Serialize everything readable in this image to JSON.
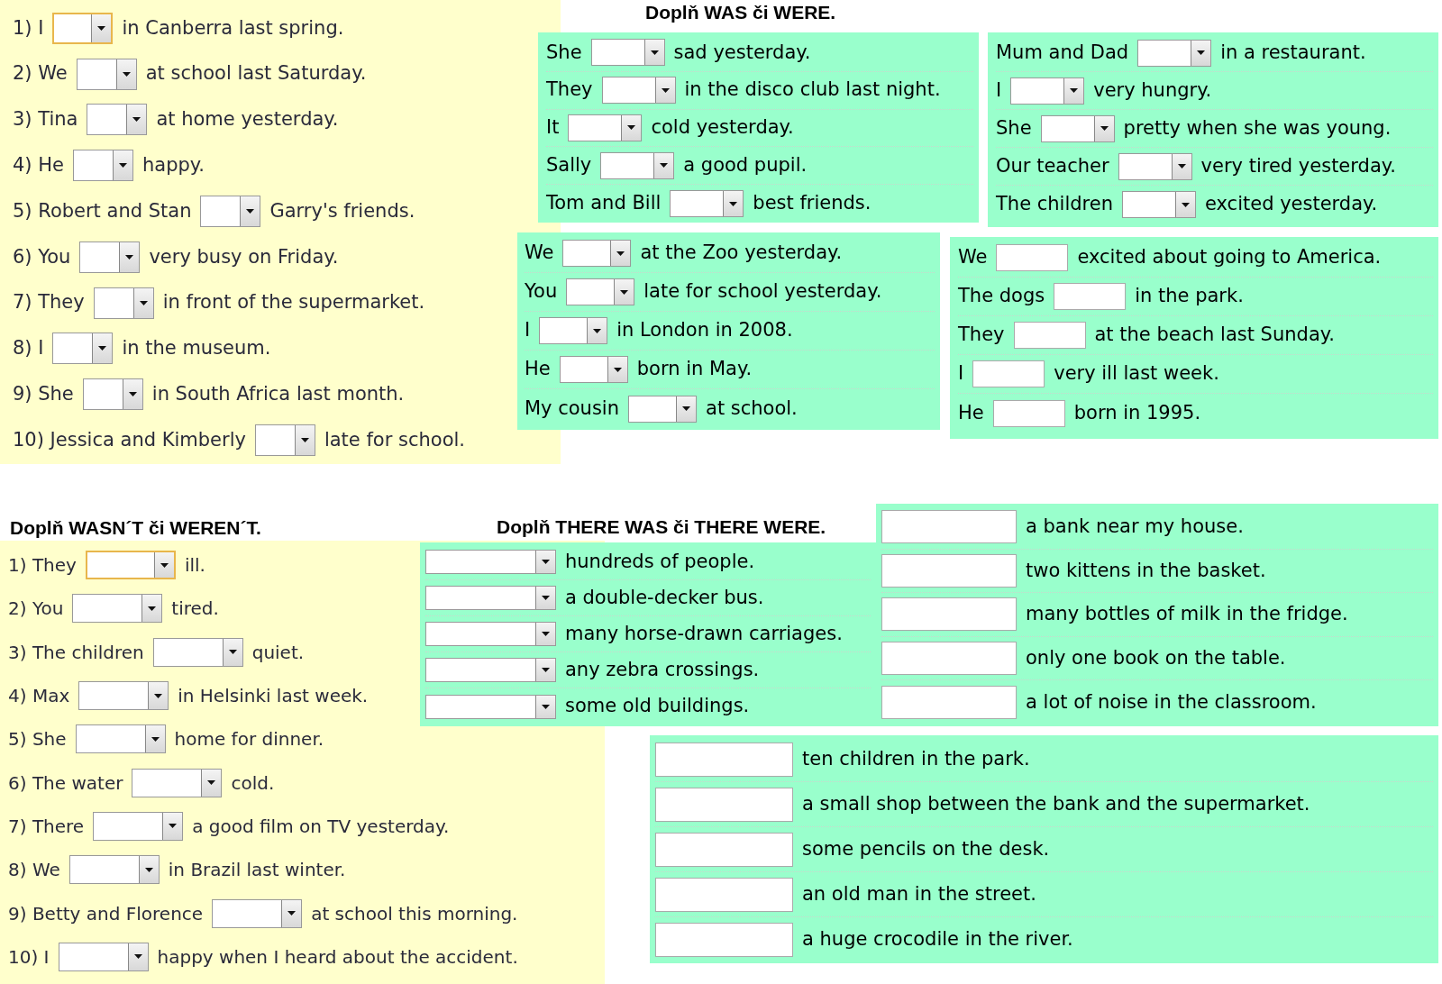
{
  "was_were_numbered": {
    "kind": "select",
    "items": [
      {
        "label": "1) I",
        "rest": "in Canberra last spring.",
        "focused": true
      },
      {
        "label": "2) We",
        "rest": "at school last Saturday.",
        "focused": false
      },
      {
        "label": "3) Tina",
        "rest": "at home yesterday.",
        "focused": false
      },
      {
        "label": "4) He",
        "rest": "happy.",
        "focused": false
      },
      {
        "label": "5) Robert and Stan",
        "rest": "Garry's friends.",
        "focused": false
      },
      {
        "label": "6) You",
        "rest": "very busy on Friday.",
        "focused": false
      },
      {
        "label": "7) They",
        "rest": "in front of the supermarket.",
        "focused": false
      },
      {
        "label": "8) I",
        "rest": "in the museum.",
        "focused": false
      },
      {
        "label": "9) She",
        "rest": "in South Africa last month.",
        "focused": false
      },
      {
        "label": "10) Jessica and Kimberly",
        "rest": "late for school.",
        "focused": false
      }
    ]
  },
  "was_were_title": "Doplň WAS či WERE.",
  "was_were_panels": [
    {
      "kind": "select",
      "items": [
        {
          "subject": "She",
          "rest": "sad yesterday."
        },
        {
          "subject": "They",
          "rest": "in the disco club last night."
        },
        {
          "subject": "It",
          "rest": "cold yesterday."
        },
        {
          "subject": "Sally",
          "rest": "a good pupil."
        },
        {
          "subject": "Tom and Bill",
          "rest": "best friends."
        }
      ]
    },
    {
      "kind": "select",
      "items": [
        {
          "subject": "Mum and Dad",
          "rest": "in a restaurant."
        },
        {
          "subject": "I",
          "rest": "very hungry."
        },
        {
          "subject": "She",
          "rest": "pretty when she was young."
        },
        {
          "subject": "Our teacher",
          "rest": "very tired yesterday."
        },
        {
          "subject": "The children",
          "rest": "excited yesterday."
        }
      ]
    },
    {
      "kind": "select",
      "items": [
        {
          "subject": "We",
          "rest": "at the Zoo yesterday."
        },
        {
          "subject": "You",
          "rest": "late for school yesterday."
        },
        {
          "subject": "I",
          "rest": "in London in 2008."
        },
        {
          "subject": "He",
          "rest": "born in May."
        },
        {
          "subject": "My cousin",
          "rest": "at school."
        }
      ]
    },
    {
      "kind": "text",
      "items": [
        {
          "subject": "We",
          "rest": "excited about going to America."
        },
        {
          "subject": "The dogs",
          "rest": "in the park."
        },
        {
          "subject": "They",
          "rest": "at the beach last Sunday."
        },
        {
          "subject": "I",
          "rest": "very ill last week."
        },
        {
          "subject": "He",
          "rest": "born in 1995."
        }
      ]
    }
  ],
  "wasnt_werent": {
    "title": "Doplň WASN´T či WEREN´T.",
    "kind": "select",
    "items": [
      {
        "label": "1) They",
        "rest": "ill.",
        "focused": true
      },
      {
        "label": "2) You",
        "rest": "tired.",
        "focused": false
      },
      {
        "label": "3) The children",
        "rest": "quiet.",
        "focused": false
      },
      {
        "label": "4) Max",
        "rest": "in Helsinki last week.",
        "focused": false
      },
      {
        "label": "5) She",
        "rest": "home for dinner.",
        "focused": false
      },
      {
        "label": "6) The water",
        "rest": "cold.",
        "focused": false
      },
      {
        "label": "7) There",
        "rest": "a good film on TV yesterday.",
        "focused": false
      },
      {
        "label": "8) We",
        "rest": "in Brazil last winter.",
        "focused": false
      },
      {
        "label": "9) Betty and Florence",
        "rest": "at school this morning.",
        "focused": false
      },
      {
        "label": "10) I",
        "rest": "happy when I heard about the accident.",
        "focused": false
      }
    ]
  },
  "there_was_were": {
    "title": "Doplň THERE WAS či THERE WERE.",
    "panels": [
      {
        "kind": "select",
        "items": [
          {
            "rest": "hundreds of people."
          },
          {
            "rest": "a double-decker bus."
          },
          {
            "rest": "many horse-drawn carriages."
          },
          {
            "rest": "any zebra crossings."
          },
          {
            "rest": "some old buildings."
          }
        ]
      },
      {
        "kind": "text",
        "items": [
          {
            "rest": "a bank near my house."
          },
          {
            "rest": "two kittens in the basket."
          },
          {
            "rest": "many bottles of milk in the fridge."
          },
          {
            "rest": "only one book on the table."
          },
          {
            "rest": "a lot of noise in the classroom."
          }
        ]
      },
      {
        "kind": "text",
        "items": [
          {
            "rest": "ten children in the park."
          },
          {
            "rest": "a small shop between the bank and the supermarket."
          },
          {
            "rest": "some pencils on the desk."
          },
          {
            "rest": "an old man in the street."
          },
          {
            "rest": "a huge crocodile in the river."
          }
        ]
      }
    ]
  }
}
